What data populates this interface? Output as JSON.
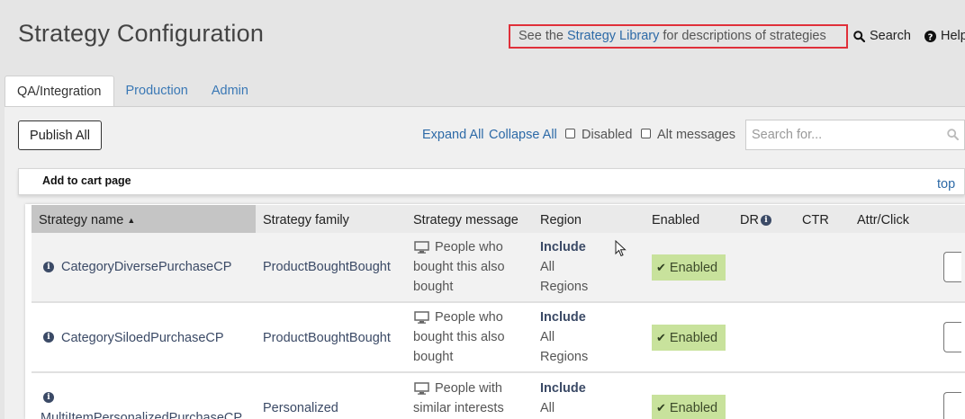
{
  "page": {
    "title": "Strategy Configuration",
    "library_notice": {
      "prefix": "See the ",
      "link": "Strategy Library",
      "suffix": " for descriptions of strategies"
    },
    "search_link": "Search",
    "help_link": "Help"
  },
  "tabs": [
    {
      "label": "QA/Integration",
      "active": true
    },
    {
      "label": "Production",
      "active": false
    },
    {
      "label": "Admin",
      "active": false
    }
  ],
  "toolbar": {
    "publish_all": "Publish All",
    "expand_all": "Expand All",
    "collapse_all": "Collapse All",
    "disabled_label": "Disabled",
    "alt_messages_label": "Alt messages",
    "search_placeholder": "Search for..."
  },
  "section": {
    "title": "Add to cart page",
    "top_link": "top"
  },
  "table": {
    "headers": {
      "name": "Strategy name",
      "sort_indicator": "▲",
      "family": "Strategy family",
      "message": "Strategy message",
      "region": "Region",
      "enabled": "Enabled",
      "dr": "DR",
      "ctr": "CTR",
      "attr": "Attr/Click"
    },
    "rows": [
      {
        "name": "CategoryDiversePurchaseCP",
        "family": "ProductBoughtBought",
        "message": [
          "People who",
          "bought this also",
          "bought"
        ],
        "region_bold": "Include",
        "region": [
          "All",
          "Regions"
        ],
        "enabled": "Enabled"
      },
      {
        "name": "CategorySiloedPurchaseCP",
        "family": "ProductBoughtBought",
        "message": [
          "People who",
          "bought this also",
          "bought"
        ],
        "region_bold": "Include",
        "region": [
          "All",
          "Regions"
        ],
        "enabled": "Enabled"
      },
      {
        "name": "MultiItemPersonalizedPurchaseCP",
        "family": "Personalized",
        "message": [
          "People with",
          "similar interests"
        ],
        "region_bold": "Include",
        "region": [
          "All"
        ],
        "enabled": "Enabled"
      }
    ]
  },
  "colors": {
    "link": "#2d6aa7",
    "highlight_border": "#e0303a",
    "enabled_badge": "#c8e29c",
    "text_dark": "#3b4a66"
  },
  "icons": [
    "search-icon",
    "help-icon",
    "info-icon",
    "monitor-icon",
    "check-icon",
    "sort-up-icon",
    "cursor-icon"
  ]
}
